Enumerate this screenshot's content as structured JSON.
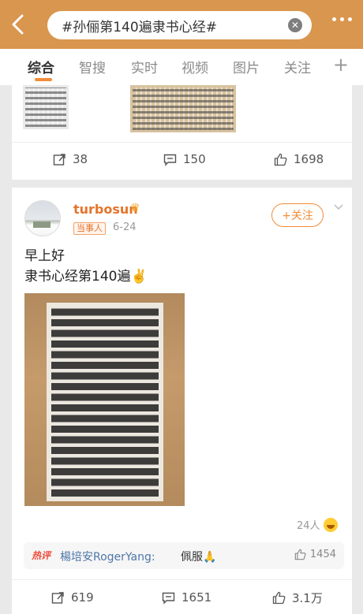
{
  "search": {
    "query": "#孙俪第140遍隶书心经#",
    "clear_icon": "clear-icon"
  },
  "tabs": [
    "综合",
    "智搜",
    "实时",
    "视频",
    "图片",
    "关注"
  ],
  "tab_more": "+",
  "card1": {
    "repost_count": "38",
    "comment_count": "150",
    "like_count": "1698"
  },
  "post": {
    "username": "turbosun",
    "badge": "当事人",
    "date": "6-24",
    "follow_label": "+关注",
    "text_line1": "早上好",
    "text_line2": "隶书心经第140遍✌️",
    "likes_note": "24人",
    "hot_comment": {
      "tag": "热评",
      "author": "楊培安RogerYang:",
      "text": "佩服🙏",
      "likes": "1454"
    },
    "repost_count": "619",
    "comment_count": "1651",
    "like_count": "3.1万"
  },
  "colors": {
    "accent": "#f28c38",
    "topbar": "#d9964e",
    "link": "#4f77a8",
    "hot_tag": "#ef4a3a"
  }
}
